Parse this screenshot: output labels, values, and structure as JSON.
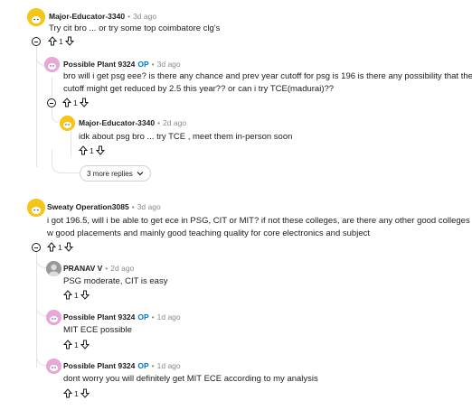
{
  "comments": [
    {
      "author": "Major-Educator-3340",
      "op": "",
      "time": "3d ago",
      "text": "Try cit bro ... or try some top coimbatore clg's",
      "votes": "1"
    },
    {
      "author": "Possible Plant 9324",
      "op": "OP",
      "time": "3d ago",
      "text_line1": "bro will i get psg eee? is there any chance and prev year cutoff for psg is 196 is there any possibility that the",
      "text_line2": "cutoff might get reduced by 2.5 this year?? or can i try TCE(madurai)??",
      "votes": "1"
    },
    {
      "author": "Major-Educator-3340",
      "op": "",
      "time": "2d ago",
      "text": "idk about psg bro ... try TCE , meet them in-person soon",
      "votes": "1"
    },
    {
      "author": "Sweaty Operation3085",
      "op": "",
      "time": "3d ago",
      "text_line1": "i got 196.5, will i be able to get ece in PSG, CIT or MIT? if not these colleges, are there any other good colleges",
      "text_line2": "w good placements and mainly good teaching quality for core electronics and subject",
      "votes": "1"
    },
    {
      "author": "PRANAV V",
      "op": "",
      "time": "2d ago",
      "text": "PSG moderate, CIT is easy",
      "votes": "1"
    },
    {
      "author": "Possible Plant 9324",
      "op": "OP",
      "time": "1d ago",
      "text": "MIT ECE possible",
      "votes": "1"
    },
    {
      "author": "Possible Plant 9324",
      "op": "OP",
      "time": "1d ago",
      "text": "dont worry you will definitely get MIT ECE according to my analysis",
      "votes": "1"
    }
  ],
  "more_replies": {
    "label": "3 more replies"
  },
  "separator": "•",
  "colors": {
    "op": "#0079d3",
    "meta": "#878a8c",
    "thread_line": "#e3e3e3"
  }
}
